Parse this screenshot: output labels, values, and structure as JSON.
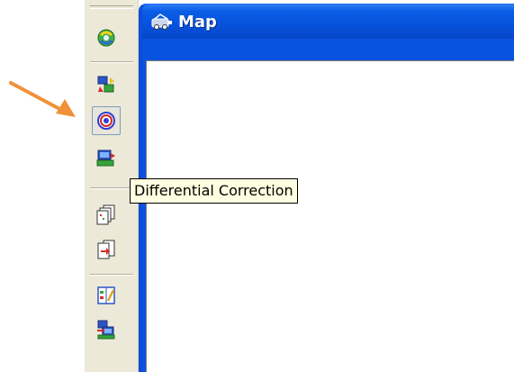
{
  "window": {
    "title": "Map",
    "title_icon": "map-window-icon"
  },
  "toolbar": {
    "buttons": [
      {
        "name": "refresh-globe-icon",
        "tooltip": ""
      },
      {
        "name": "data-transfer-icon",
        "tooltip": ""
      },
      {
        "name": "target-icon",
        "tooltip": ""
      },
      {
        "name": "differential-correction-icon",
        "tooltip": "Differential Correction"
      },
      {
        "name": "copy-files-icon",
        "tooltip": ""
      },
      {
        "name": "export-files-icon",
        "tooltip": ""
      },
      {
        "name": "edit-data-icon",
        "tooltip": ""
      },
      {
        "name": "connect-device-icon",
        "tooltip": ""
      }
    ]
  },
  "tooltip": {
    "text": "Differential Correction"
  },
  "annotation": {
    "arrow_color": "#F0913A"
  },
  "colors": {
    "toolbar_bg": "#ECE9D8",
    "title_blue": "#0752DC",
    "tooltip_bg": "#FFFFE1"
  }
}
